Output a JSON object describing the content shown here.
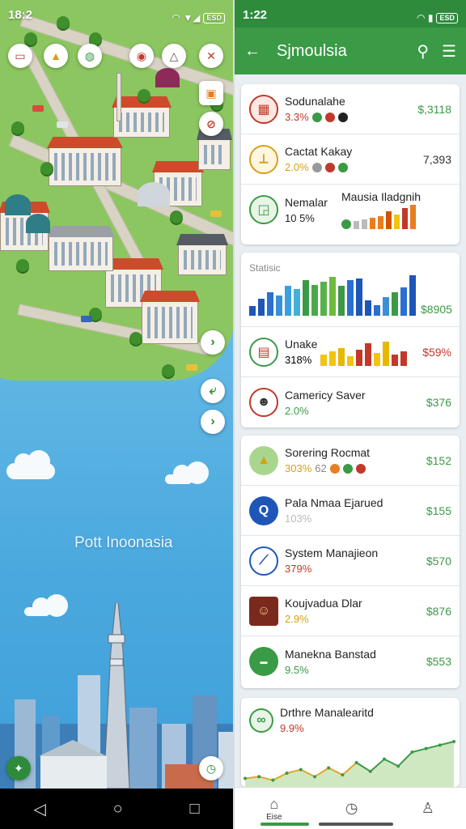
{
  "left": {
    "status": {
      "time": "18:2",
      "signal": "▼◢",
      "battery": "ESD"
    },
    "map_label": "Pott Inoonasia",
    "nav": {
      "back": "◁",
      "home": "○",
      "recent": "□"
    }
  },
  "right": {
    "status": {
      "time": "1:22",
      "battery": "ESD"
    },
    "appbar": {
      "title": "Sjmoulsia"
    },
    "card1": [
      {
        "name": "Sodunalahe",
        "pct": "3.3%",
        "value": "$,3118",
        "pct_color": "#c0392b"
      },
      {
        "name": "Cactat Kakay",
        "pct": "2.0%",
        "value": "7,393",
        "pct_color": "#d4a017"
      },
      {
        "name": "Nemalar",
        "pct": "10 5%",
        "sub": "Mausia Iladgnih",
        "pct_color": "#222"
      }
    ],
    "card2": {
      "label": "Statisic",
      "value": "$8905",
      "chart_values": [
        12,
        22,
        30,
        26,
        38,
        34,
        46,
        40,
        44,
        50,
        38,
        46,
        48,
        20,
        14,
        24,
        30,
        36,
        52
      ],
      "rows": [
        {
          "name": "Unake",
          "pct": "318%",
          "value": "$59%",
          "pct_color": "#222"
        },
        {
          "name": "Camericy Saver",
          "pct": "2.0%",
          "value": "$376",
          "pct_color": "#3a9a45"
        }
      ]
    },
    "card3": [
      {
        "name": "Sorering Rocmat",
        "pct": "303%",
        "extra": "62",
        "value": "$152",
        "pct_color": "#d4a017"
      },
      {
        "name": "Pala Nmaa Ejarued",
        "pct": "103%",
        "value": "$155",
        "pct_color": "#bbb"
      },
      {
        "name": "System Manajieon",
        "pct": "379%",
        "value": "$570",
        "pct_color": "#c0392b"
      },
      {
        "name": "Koujvadua Dlar",
        "pct": "2.9%",
        "value": "$876",
        "pct_color": "#d4a017"
      },
      {
        "name": "Manekna Banstad",
        "pct": "9.5%",
        "value": "$553",
        "pct_color": "#3a9a45"
      }
    ],
    "card4": {
      "name": "Drthre Manalearitd",
      "pct": "9.9%",
      "chart_values": [
        3,
        4,
        2,
        6,
        8,
        4,
        9,
        5,
        12,
        7,
        14,
        10,
        18,
        20,
        22,
        24
      ]
    },
    "nav": {
      "home_label": "Eise"
    }
  }
}
